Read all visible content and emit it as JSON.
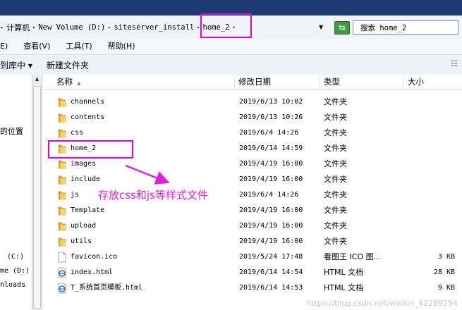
{
  "address_bar": {
    "crumbs": [
      "计算机",
      "New Volume (D:)",
      "siteserver_install",
      "home_2"
    ],
    "search_placeholder": "搜索 home_2",
    "go_icon": "refresh-arrows-icon"
  },
  "menu": [
    "E)",
    "查看(V)",
    "工具(T)",
    "帮助(H)"
  ],
  "toolbar": {
    "include_in_library": "到库中 ▾",
    "new_folder": "新建文件夹"
  },
  "nav_pane": {
    "recent_places": "的位置",
    "drive_c": "(C:)",
    "drive_d": "me (D:)",
    "downloads": "nloads"
  },
  "columns": {
    "name": "名称",
    "date": "修改日期",
    "type": "类型",
    "size": "大小"
  },
  "files": [
    {
      "name": "channels",
      "date": "2019/6/13 10:02",
      "type": "文件夹",
      "size": "",
      "icon": "folder-icon"
    },
    {
      "name": "contents",
      "date": "2019/6/13 10:26",
      "type": "文件夹",
      "size": "",
      "icon": "folder-icon"
    },
    {
      "name": "css",
      "date": "2019/6/4 14:26",
      "type": "文件夹",
      "size": "",
      "icon": "folder-icon"
    },
    {
      "name": "home_2",
      "date": "2019/6/14 14:59",
      "type": "文件夹",
      "size": "",
      "icon": "folder-icon"
    },
    {
      "name": "images",
      "date": "2019/4/19 16:00",
      "type": "文件夹",
      "size": "",
      "icon": "folder-icon"
    },
    {
      "name": "include",
      "date": "2019/4/19 16:00",
      "type": "文件夹",
      "size": "",
      "icon": "folder-icon"
    },
    {
      "name": "js",
      "date": "2019/6/4 14:26",
      "type": "文件夹",
      "size": "",
      "icon": "folder-icon"
    },
    {
      "name": "Template",
      "date": "2019/4/19 16:00",
      "type": "文件夹",
      "size": "",
      "icon": "folder-icon"
    },
    {
      "name": "upload",
      "date": "2019/4/19 16:00",
      "type": "文件夹",
      "size": "",
      "icon": "folder-icon"
    },
    {
      "name": "utils",
      "date": "2019/4/19 16:00",
      "type": "文件夹",
      "size": "",
      "icon": "folder-icon"
    },
    {
      "name": "favicon.ico",
      "date": "2019/5/24 17:48",
      "type": "看图王 ICO 图...",
      "size": "3 KB",
      "icon": "ico-file-icon"
    },
    {
      "name": "index.html",
      "date": "2019/6/14 14:54",
      "type": "HTML 文档",
      "size": "28 KB",
      "icon": "ie-html-icon"
    },
    {
      "name": "T_系统首页模板.html",
      "date": "2019/6/14 14:53",
      "type": "HTML 文档",
      "size": "9 KB",
      "icon": "ie-html-icon"
    }
  ],
  "annotation": {
    "text": "存放css和js等样式文件",
    "color": "#e020e0"
  },
  "watermark": "https://blog.csdn.net/weixin_42289254"
}
